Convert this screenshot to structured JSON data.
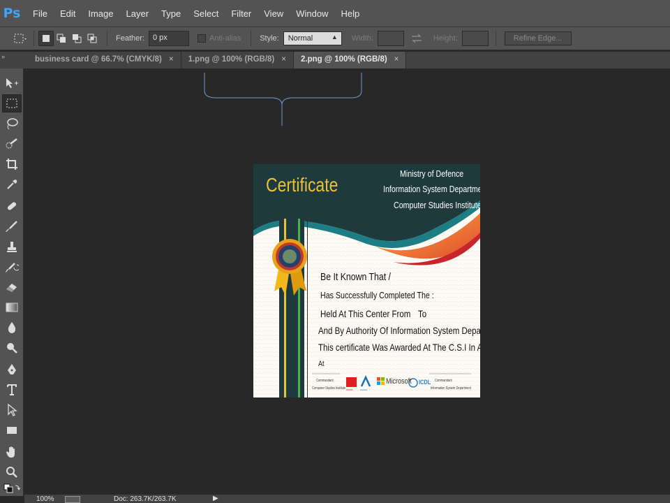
{
  "app": {
    "logo": "Ps"
  },
  "menu": [
    "File",
    "Edit",
    "Image",
    "Layer",
    "Type",
    "Select",
    "Filter",
    "View",
    "Window",
    "Help"
  ],
  "options": {
    "feather_label": "Feather:",
    "feather_value": "0 px",
    "antialias_label": "Anti-alias",
    "style_label": "Style:",
    "style_value": "Normal",
    "width_label": "Width:",
    "height_label": "Height:",
    "refine_edge": "Refine Edge..."
  },
  "tabs": [
    {
      "label": "business card @ 66.7% (CMYK/8)",
      "active": false
    },
    {
      "label": "1.png @ 100% (RGB/8)",
      "active": false
    },
    {
      "label": "2.png @ 100% (RGB/8)",
      "active": true
    }
  ],
  "tab_close": "×",
  "panel_collapse": "»",
  "certificate": {
    "title": "Certificate",
    "org_lines": [
      "Ministry of Defence",
      "Information System Department",
      "Computer Studies Institute"
    ],
    "body_lines": [
      "Be It Known That /",
      "Has Successfully Completed The :",
      "Held At This Center From",
      "To",
      "And By Authority Of Information System Department.",
      "This certificate Was Awarded At The C.S.I In Alexandria.",
      "At"
    ],
    "signature_left": [
      "Commandant",
      "Computer Studies Institute"
    ],
    "signature_right": [
      "Commandant",
      "Information System Department"
    ],
    "logos": [
      "Adobe",
      "Autodesk",
      "Microsoft",
      "ICDL"
    ],
    "colors": {
      "dark_teal": "#1f3a3c",
      "title_gold": "#e8c23a",
      "teal_wave": "#1c7e84",
      "orange_wave": "#f07a3a",
      "red_wave": "#c8242c"
    }
  },
  "status": {
    "zoom": "100%",
    "doc": "Doc: 263.7K/263.7K"
  }
}
